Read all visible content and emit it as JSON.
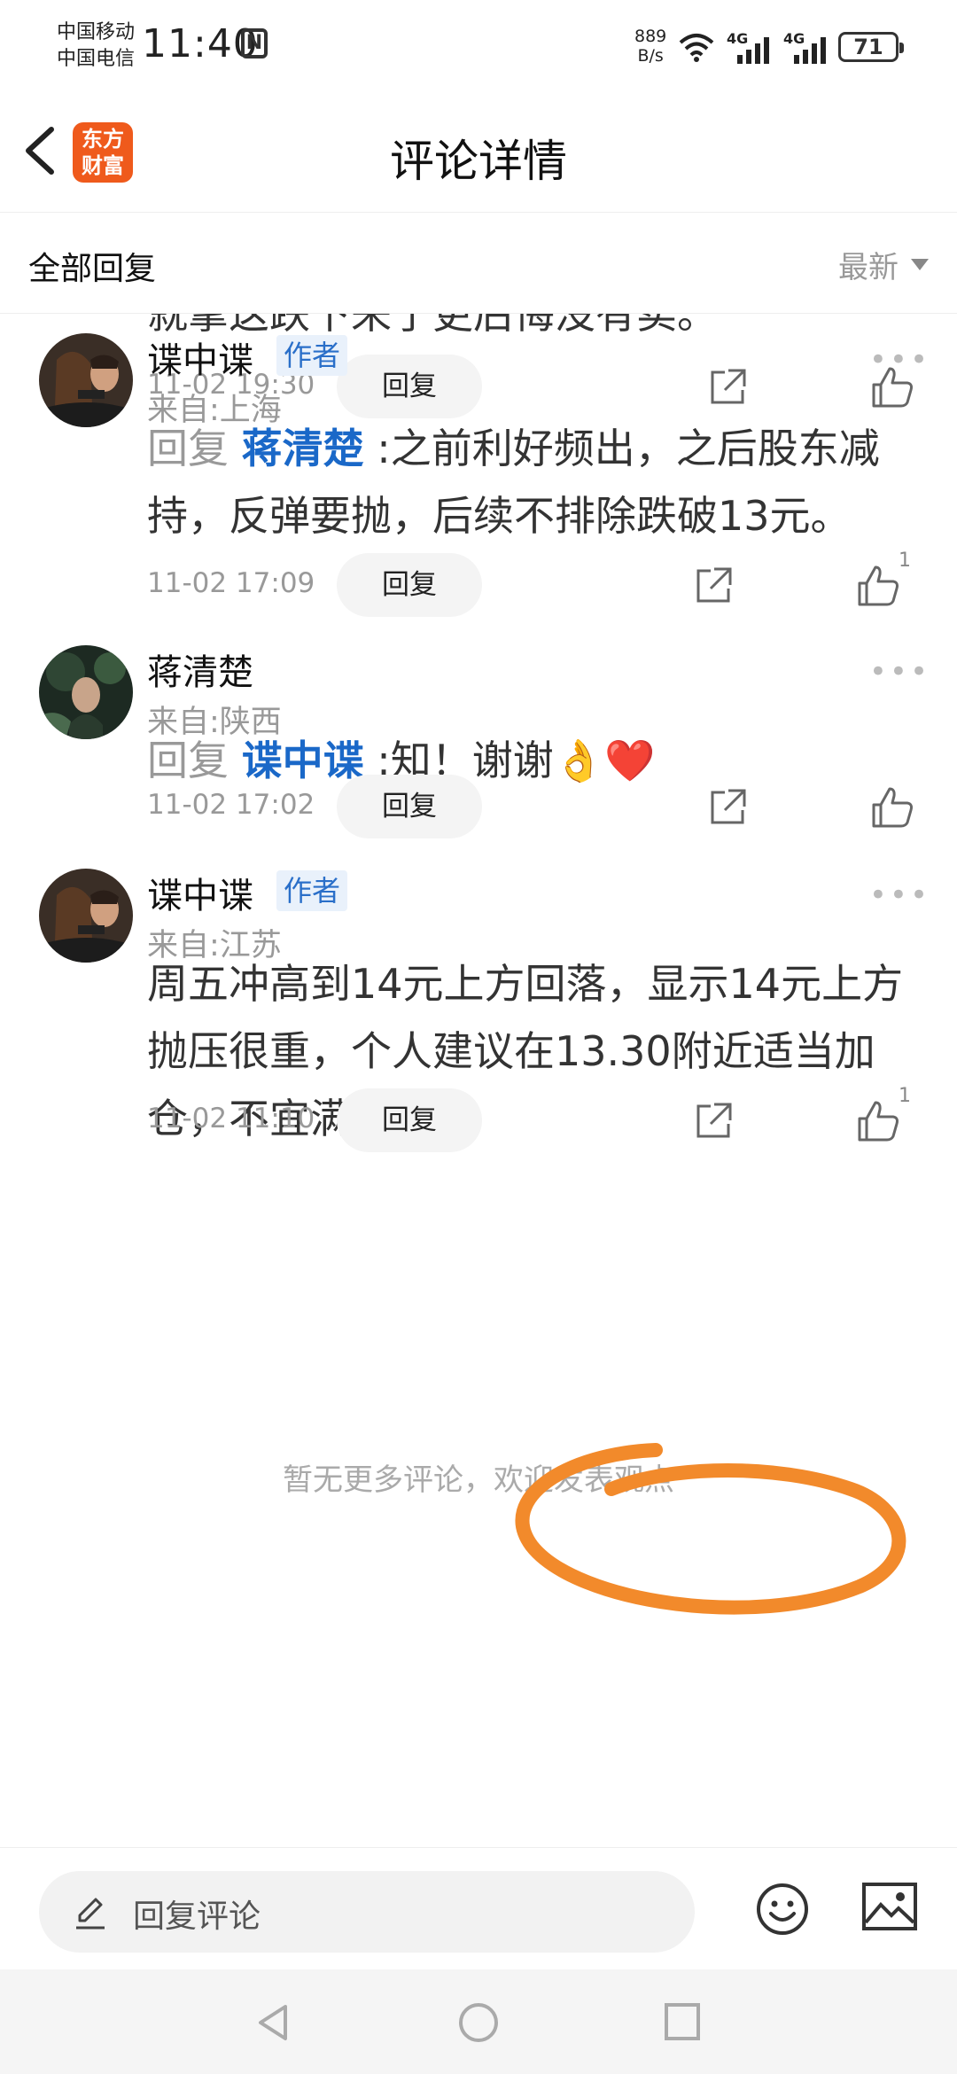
{
  "status_bar": {
    "carrier_1": "中国移动",
    "carrier_2": "中国电信",
    "time": "11:40",
    "net_speed_value": "889",
    "net_speed_unit": "B/s",
    "signal_1_label": "4G",
    "signal_2_label": "4G",
    "battery": "71"
  },
  "header": {
    "title": "评论详情",
    "logo_text": "东方财富",
    "logo_color": "#ef5a1c"
  },
  "filter": {
    "title": "全部回复",
    "sort_label": "最新"
  },
  "partial_top": {
    "text": "就拿这跌下来了更后悔没有卖。",
    "date": "11-02 19:30",
    "reply_label": "回复"
  },
  "comments": [
    {
      "username": "谍中谍",
      "badge": "作者",
      "location": "来自:上海",
      "prefix": "回复",
      "mention": "蒋清楚",
      "separator": ":",
      "text": "之前利好频出，之后股东减持，反弹要抛，后续不排除跌破13元。",
      "date": "11-02 17:09",
      "reply_label": "回复",
      "likes": "1"
    },
    {
      "username": "蒋清楚",
      "location": "来自:陕西",
      "prefix": "回复",
      "mention": "谍中谍",
      "separator": ":",
      "text": "知！谢谢👌❤️",
      "date": "11-02 17:02",
      "reply_label": "回复"
    },
    {
      "username": "谍中谍",
      "badge": "作者",
      "location": "来自:江苏",
      "text": "周五冲高到14元上方回落，显示14元上方抛压很重，个人建议在13.30附近适当加仓，不宜满仓！",
      "date": "11-02 11:10",
      "reply_label": "回复",
      "likes": "1"
    }
  ],
  "end_note": "暂无更多评论，欢迎发表观点",
  "input_bar": {
    "placeholder": "回复评论"
  },
  "colors": {
    "mention": "#1a68c8",
    "author_badge_bg": "#e9f1fb",
    "annotation": "#f28a2b"
  },
  "icons": [
    "back-icon",
    "share-icon",
    "like-icon",
    "more-icon",
    "pencil-icon",
    "emoji-icon",
    "image-icon",
    "nav-back-icon",
    "nav-home-icon",
    "nav-recents-icon"
  ]
}
